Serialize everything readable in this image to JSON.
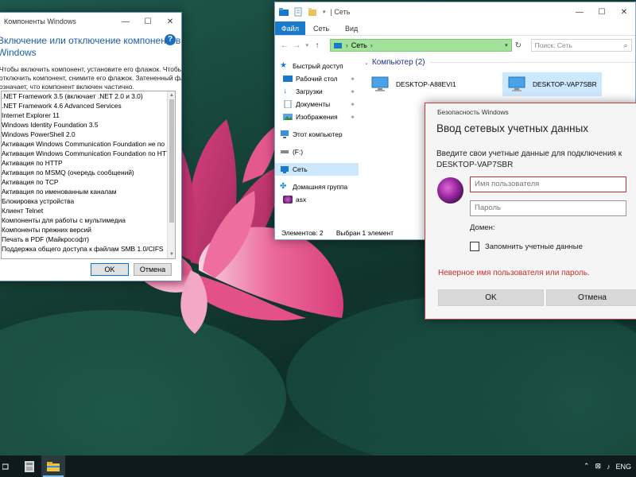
{
  "features_window": {
    "title": "Компоненты Windows",
    "heading_line1": "Включение или отключение компонентов",
    "heading_line2": "Windows",
    "help_label": "?",
    "description": [
      "Чтобы включить компонент, установите его флажок. Чтобы",
      "отключить компонент, снимите его флажок. Затененный флажок",
      "означает, что компонент включен частично."
    ],
    "items": [
      ".NET Framework 3.5 (включает .NET 2.0 и 3.0)",
      ".NET Framework 4.6 Advanced Services",
      "Internet Explorer 11",
      "Windows Identity Foundation 3.5",
      "Windows PowerShell 2.0",
      "Активация Windows Communication Foundation не по HTTP",
      "Активация Windows Communication Foundation по HTTP",
      "Активация по HTTP",
      "Активация по MSMQ (очередь сообщений)",
      "Активация по TCP",
      "Активация по именованным каналам",
      "Блокировка устройства",
      "Клиент Telnet",
      "Компоненты для работы с мультимедиа",
      "Компоненты прежних версий",
      "Печать в PDF (Майкрософт)",
      "Поддержка общего доступа к файлам SMB 1.0/CIFS"
    ],
    "ok_label": "OK",
    "cancel_label": "Отмена"
  },
  "explorer": {
    "title": "Сеть",
    "tabs": [
      "Файл",
      "Сеть",
      "Вид"
    ],
    "address": "Сеть",
    "search_placeholder": "Поиск: Сеть",
    "nav": [
      {
        "label": "Быстрый доступ",
        "icon": "star-icon"
      },
      {
        "label": "Рабочий стол",
        "icon": "desktop-folder-icon",
        "pinned": true
      },
      {
        "label": "Загрузки",
        "icon": "download-icon",
        "pinned": true
      },
      {
        "label": "Документы",
        "icon": "documents-icon",
        "pinned": true
      },
      {
        "label": "Изображения",
        "icon": "pictures-icon",
        "pinned": true
      },
      {
        "label": "Этот компьютер",
        "icon": "pc-icon"
      },
      {
        "label": "(F:)",
        "icon": "drive-icon"
      },
      {
        "label": "Сеть",
        "icon": "network-icon",
        "selected": true
      },
      {
        "label": "Домашняя группа",
        "icon": "homegroup-icon"
      },
      {
        "label": "asx",
        "icon": "user-icon"
      }
    ],
    "group_header": "Компьютер (2)",
    "computers": [
      {
        "name": "DESKTOP-A88EVI1",
        "selected": false
      },
      {
        "name": "DESKTOP-VAP7SBR",
        "selected": true
      }
    ],
    "status_items": "Элементов: 2",
    "status_selected": "Выбран 1 элемент"
  },
  "credentials": {
    "small_title": "Безопасность Windows",
    "heading": "Ввод сетевых учетных данных",
    "prompt": "Введите свои учетные данные для подключения к",
    "target": "DESKTOP-VAP7SBR",
    "username_placeholder": "Имя пользователя",
    "password_placeholder": "Пароль",
    "domain_label": "Домен:",
    "remember_label": "Запомнить учетные данные",
    "remember_checked": false,
    "error": "Неверное имя пользователя или пароль.",
    "ok_label": "OK",
    "cancel_label": "Отмена"
  },
  "taskbar": {
    "apps": [
      {
        "name": "task-view",
        "active": false
      },
      {
        "name": "features-app",
        "active": false
      },
      {
        "name": "explorer-app",
        "active": true
      }
    ],
    "language": "ENG"
  },
  "colors": {
    "accent": "#1979ca",
    "address_bar": "#a2e29a",
    "error": "#c52f2f",
    "selection": "#cce8ff"
  }
}
